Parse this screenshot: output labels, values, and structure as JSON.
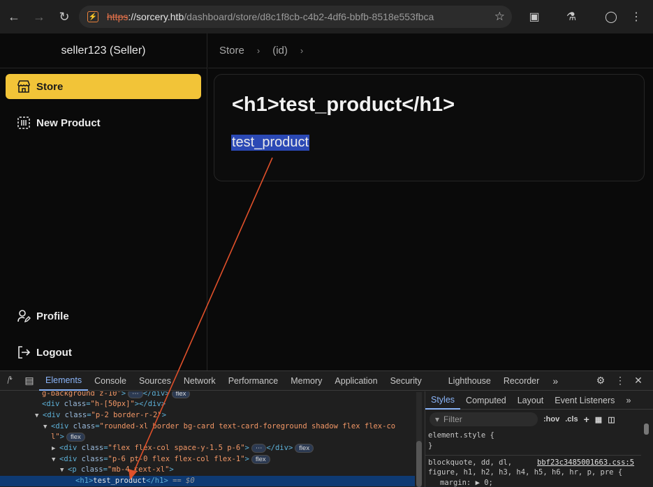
{
  "browser": {
    "url_scheme": "https",
    "url_host": "://sorcery.htb",
    "url_path": "/dashboard/store/d8c1f8cb-c4b2-4df6-bbfb-8518e553fbca"
  },
  "sidebar": {
    "user_label": "seller123 (Seller)",
    "items": [
      {
        "label": "Store",
        "icon": "store-icon",
        "active": true
      },
      {
        "label": "New Product",
        "icon": "new-product-icon",
        "active": false
      }
    ],
    "bottom_items": [
      {
        "label": "Profile",
        "icon": "user-pen-icon"
      },
      {
        "label": "Logout",
        "icon": "logout-icon"
      }
    ],
    "accent_color": "#f2c438"
  },
  "breadcrumb": [
    "Store",
    "(id)"
  ],
  "product": {
    "title": "<h1>test_product</h1>",
    "description": "test_product"
  },
  "devtools": {
    "tabs": [
      "Elements",
      "Console",
      "Sources",
      "Network",
      "Performance",
      "Memory",
      "Application",
      "Security",
      "Lighthouse",
      "Recorder"
    ],
    "active_tab": "Elements",
    "dom_lines": [
      {
        "p1": "g-background z-10\"",
        "p2": ">",
        "ellipsis": "⋯",
        "p3": "</div>",
        "pill": "flex"
      },
      {
        "p1": "<div ",
        "a": "class",
        "v": "\"h-[50px]\"",
        "p3": "></div>"
      },
      {
        "tri": "▼",
        "p1": "<div ",
        "a": "class",
        "v": "\"p-2 border-r-2\"",
        "p3": ">"
      },
      {
        "tri": "▼",
        "p1": "<div ",
        "a": "class",
        "v": "\"rounded-xl border bg-card text-card-foreground shadow flex flex-co"
      },
      {
        "v": "l\"",
        "p3": ">",
        "pill": "flex"
      },
      {
        "tri": "▶",
        "p1": "<div ",
        "a": "class",
        "v": "\"flex flex-col space-y-1.5 p-6\"",
        "p3": ">",
        "ellipsis": "⋯",
        "p4": "</div>",
        "pill": "flex"
      },
      {
        "tri": "▼",
        "p1": "<div ",
        "a": "class",
        "v": "\"p-6 pt-0 flex flex-col flex-1\"",
        "p3": ">",
        "pill": "flex"
      },
      {
        "tri": "▼",
        "p1": "<p ",
        "a": "class",
        "v": "\"mb-4 text-xl\"",
        "p3": ">"
      },
      {
        "p1": "<h1>",
        "t": "test_product",
        "p3": "</h1>",
        "eq": " == $0"
      }
    ],
    "styles_tabs": [
      "Styles",
      "Computed",
      "Layout",
      "Event Listeners"
    ],
    "filter_placeholder": "Filter",
    "hov_label": ":hov",
    "cls_label": ".cls",
    "element_style": "element.style {",
    "element_style_close": "}",
    "rule_selector_1": "blockquote, dd, dl,",
    "rule_selector_2": "figure, h1, h2, h3, h4, h5, h6, hr, p, pre {",
    "rule_prop": "margin: ▶ 0;",
    "css_file": "bbf23c3485001663.css:5"
  }
}
